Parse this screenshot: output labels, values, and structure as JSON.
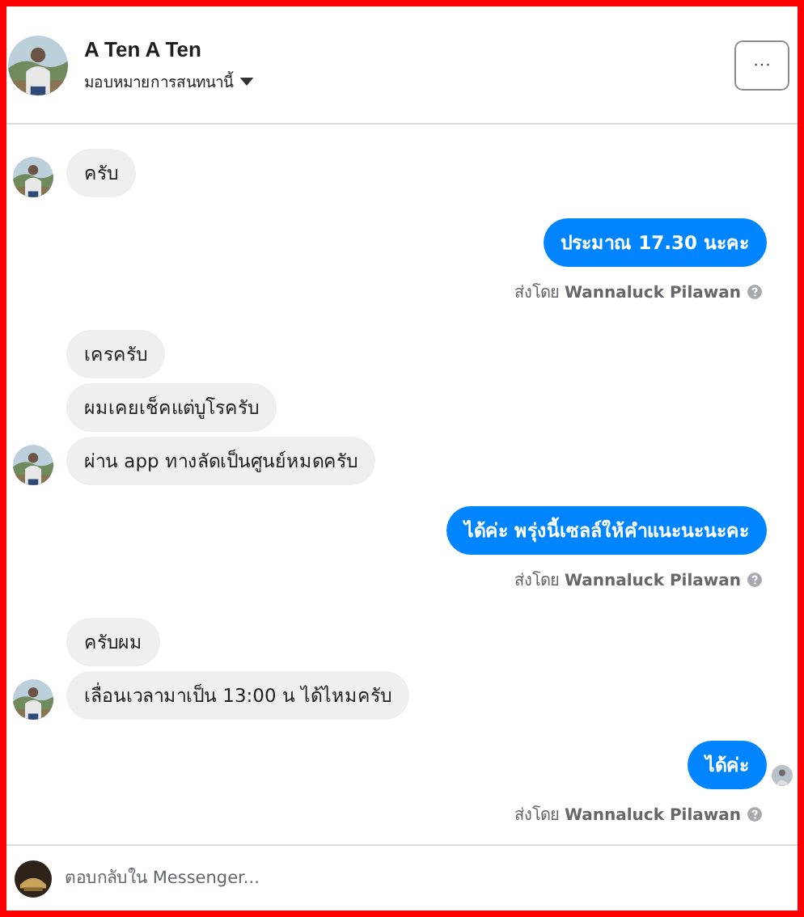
{
  "header": {
    "name": "A Ten A Ten",
    "assign_label": "มอบหมายการสนทนานี้",
    "more_label": "···"
  },
  "messages": [
    {
      "kind": "incoming",
      "text": "ครับ",
      "avatar": true
    },
    {
      "kind": "outgoing",
      "text": "ประมาณ 17.30  นะคะ",
      "note": "ส่งโดย **Wannaluck Pilawan**",
      "seen": false
    },
    {
      "kind": "incoming",
      "text": "เครครับ",
      "avatar": false
    },
    {
      "kind": "incoming",
      "text": "ผมเคยเช็คแต่บูโรครับ",
      "avatar": false
    },
    {
      "kind": "incoming",
      "text": "ผ่าน app ทางลัดเป็นศูนย์หมดครับ",
      "avatar": true
    },
    {
      "kind": "outgoing",
      "text": "ได้ค่ะ พรุ่งนี้เซลล์ให้คำแนะนะนะคะ",
      "note": "ส่งโดย **Wannaluck Pilawan**",
      "seen": false
    },
    {
      "kind": "incoming",
      "text": "ครับผม",
      "avatar": false
    },
    {
      "kind": "incoming",
      "text": "เลื่อนเวลามาเป็น 13:00 น ได้ไหมครับ",
      "avatar": true
    },
    {
      "kind": "outgoing",
      "text": "ได้ค่ะ",
      "note": "ส่งโดย **Wannaluck Pilawan**",
      "seen": true
    }
  ],
  "composer": {
    "placeholder": "ตอบกลับใน Messenger..."
  }
}
